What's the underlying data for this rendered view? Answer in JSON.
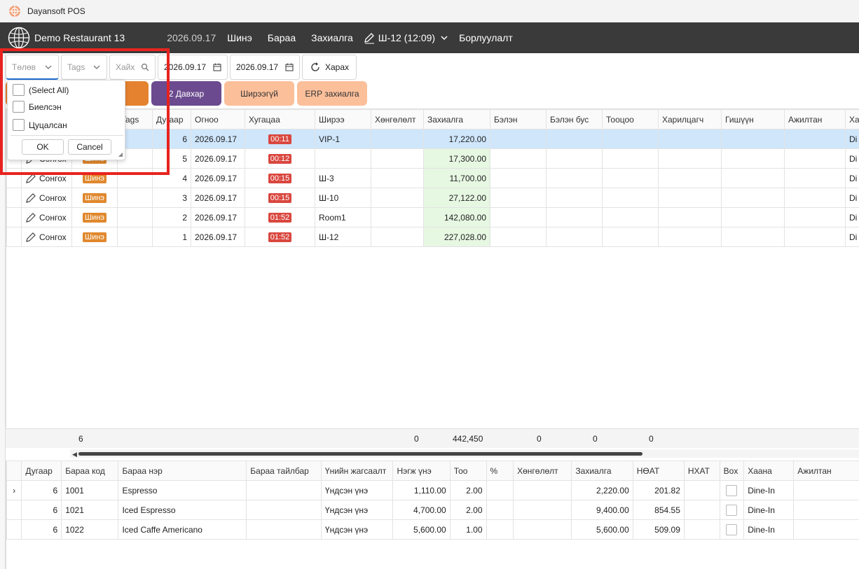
{
  "window": {
    "title": "Dayansoft POS"
  },
  "navbar": {
    "restaurant": "Demo Restaurant 13",
    "date": "2026.09.17",
    "items": [
      "Шинэ",
      "Бараа",
      "Захиалга"
    ],
    "table_label": "Ш-12 (12:09)",
    "sales": "Борлуулалт"
  },
  "filters": {
    "status_placeholder": "Төлөв",
    "tags_placeholder": "Tags",
    "search_placeholder": "Хайх",
    "date_from": "2026.09.17",
    "date_to": "2026.09.17",
    "view_label": "Харах"
  },
  "categories": [
    {
      "label": "",
      "color": "#e5822f"
    },
    {
      "label": "2 Давхар",
      "color": "#6b4a8f"
    },
    {
      "label": "Ширээгүй",
      "color": "#fbbf9a"
    },
    {
      "label": "ERP захиалга",
      "color": "#fbbf9a"
    }
  ],
  "orders": {
    "columns": [
      "",
      "",
      "",
      "Tags",
      "Дугаар",
      "Огноо",
      "Хугацаа",
      "Ширээ",
      "Хөнгөлөлт",
      "Захиалга",
      "Бэлэн",
      "Бэлэн бус",
      "Тооцоо",
      "Харилцагч",
      "Гишүүн",
      "Ажилтан",
      "Ха"
    ],
    "select_label": "Сонгох",
    "new_label": "Шинэ",
    "rows": [
      {
        "number": "6",
        "date": "2026.09.17",
        "time": "00:11",
        "table": "VIP-1",
        "order": "17,220.00",
        "staff_trunc": "Di"
      },
      {
        "number": "5",
        "date": "2026.09.17",
        "time": "00:12",
        "table": "",
        "order": "17,300.00",
        "staff_trunc": "Di"
      },
      {
        "number": "4",
        "date": "2026.09.17",
        "time": "00:15",
        "table": "Ш-3",
        "order": "11,700.00",
        "staff_trunc": "Di"
      },
      {
        "number": "3",
        "date": "2026.09.17",
        "time": "00:15",
        "table": "Ш-10",
        "order": "27,122.00",
        "staff_trunc": "Di"
      },
      {
        "number": "2",
        "date": "2026.09.17",
        "time": "01:52",
        "table": "Room1",
        "order": "142,080.00",
        "staff_trunc": "Di"
      },
      {
        "number": "1",
        "date": "2026.09.17",
        "time": "01:52",
        "table": "Ш-12",
        "order": "227,028.00",
        "staff_trunc": "Di"
      }
    ],
    "footer": {
      "count": "6",
      "discount": "0",
      "order": "442,450",
      "cash": "0",
      "noncash": "0",
      "settle": "0"
    }
  },
  "details": {
    "columns": [
      "",
      "Дугаар",
      "Бараа код",
      "Бараа нэр",
      "Бараа тайлбар",
      "Үнийн жагсаалт",
      "Нэгж үнэ",
      "Тоо",
      "%",
      "Хөнгөлөлт",
      "Захиалга",
      "НӨАТ",
      "НХАТ",
      "Box",
      "Хаана",
      "Ажилтан"
    ],
    "rows": [
      {
        "number": "6",
        "code": "1001",
        "name": "Espresso",
        "price_list": "Үндсэн үнэ",
        "unit_price": "1,110.00",
        "qty": "2.00",
        "order": "2,220.00",
        "vat": "201.82",
        "where": "Dine-In"
      },
      {
        "number": "6",
        "code": "1021",
        "name": "Iced Espresso",
        "price_list": "Үндсэн үнэ",
        "unit_price": "4,700.00",
        "qty": "2.00",
        "order": "9,400.00",
        "vat": "854.55",
        "where": "Dine-In"
      },
      {
        "number": "6",
        "code": "1022",
        "name": "Iced Caffe Americano",
        "price_list": "Үндсэн үнэ",
        "unit_price": "5,600.00",
        "qty": "1.00",
        "order": "5,600.00",
        "vat": "509.09",
        "where": "Dine-In"
      }
    ]
  },
  "dropdown": {
    "options": [
      "(Select All)",
      "Биелсэн",
      "Цуцалсан"
    ],
    "ok": "OK",
    "cancel": "Cancel"
  },
  "colors": {
    "navbar": "#3a3a3a",
    "selected_row": "#cfe6fb",
    "order_cell": "#e6f7e2",
    "badge_new": "#e0882d",
    "badge_time": "#d9473f",
    "highlight": "#e8231f"
  }
}
